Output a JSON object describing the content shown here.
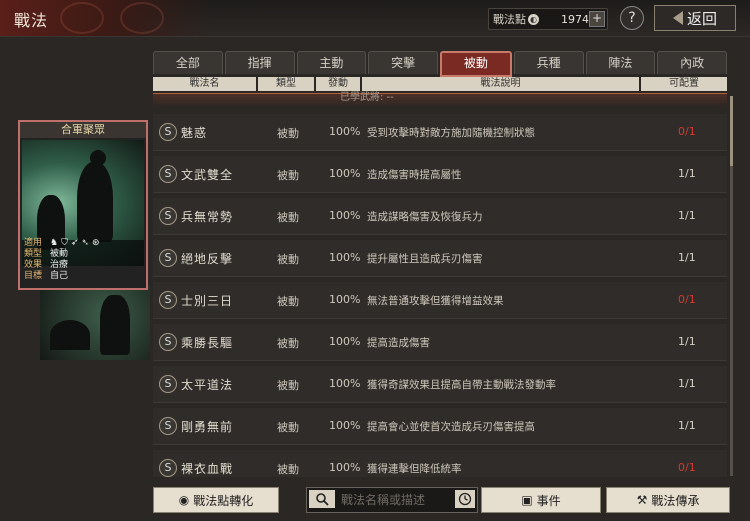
{
  "header": {
    "title": "戰法",
    "points_label": "戰法點",
    "points_value": "1974",
    "plus": "+",
    "help": "?",
    "back_label": "返回"
  },
  "tabs": [
    {
      "label": "全部"
    },
    {
      "label": "指揮"
    },
    {
      "label": "主動"
    },
    {
      "label": "突擊"
    },
    {
      "label": "被動"
    },
    {
      "label": "兵種"
    },
    {
      "label": "陣法"
    },
    {
      "label": "內政"
    }
  ],
  "active_tab": "被動",
  "columns": {
    "name": "戰法名",
    "type": "類型",
    "rate": "發動",
    "desc": "戰法說明",
    "avail": "可配置"
  },
  "partial_row_text": "已學武將: --",
  "rows": [
    {
      "badge": "S",
      "name": "魅惑",
      "type": "被動",
      "rate": "100%",
      "desc": "受到攻擊時對敵方施加隨機控制狀態",
      "avail": "0/1",
      "avail_red": true
    },
    {
      "badge": "S",
      "name": "文武雙全",
      "type": "被動",
      "rate": "100%",
      "desc": "造成傷害時提高屬性",
      "avail": "1/1",
      "avail_red": false
    },
    {
      "badge": "S",
      "name": "兵無常勢",
      "type": "被動",
      "rate": "100%",
      "desc": "造成謀略傷害及恢復兵力",
      "avail": "1/1",
      "avail_red": false
    },
    {
      "badge": "S",
      "name": "絕地反擊",
      "type": "被動",
      "rate": "100%",
      "desc": "提升屬性且造成兵刃傷害",
      "avail": "1/1",
      "avail_red": false
    },
    {
      "badge": "S",
      "name": "士別三日",
      "type": "被動",
      "rate": "100%",
      "desc": "無法普通攻擊但獲得增益效果",
      "avail": "0/1",
      "avail_red": true
    },
    {
      "badge": "S",
      "name": "乘勝長驅",
      "type": "被動",
      "rate": "100%",
      "desc": "提高造成傷害",
      "avail": "1/1",
      "avail_red": false
    },
    {
      "badge": "S",
      "name": "太平道法",
      "type": "被動",
      "rate": "100%",
      "desc": "獲得奇謀效果且提高自帶主動戰法發動率",
      "avail": "1/1",
      "avail_red": false
    },
    {
      "badge": "S",
      "name": "剛勇無前",
      "type": "被動",
      "rate": "100%",
      "desc": "提高會心並使首次造成兵刃傷害提高",
      "avail": "1/1",
      "avail_red": false
    },
    {
      "badge": "S",
      "name": "裸衣血戰",
      "type": "被動",
      "rate": "100%",
      "desc": "獲得連擊但降低統率",
      "avail": "0/1",
      "avail_red": true
    }
  ],
  "card": {
    "title": "合軍聚眾",
    "applies_label": "適用",
    "type_label": "類型",
    "type_value": "被動",
    "effect_label": "效果",
    "effect_value": "治療",
    "target_label": "目標",
    "target_value": "自己",
    "unit_icons": [
      "horse-icon",
      "shield-icon",
      "bow-icon",
      "spear-icon",
      "chariot-icon"
    ]
  },
  "footer": {
    "convert_label": "戰法點轉化",
    "search_placeholder": "戰法名稱或描述",
    "events_label": "事件",
    "inherit_label": "戰法傳承"
  },
  "colors": {
    "active_tab": "#7a2a22",
    "unavailable": "#d23a2e"
  }
}
